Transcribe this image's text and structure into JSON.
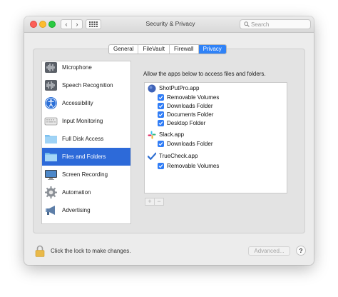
{
  "window": {
    "title": "Security & Privacy",
    "nav_back_icon": "‹",
    "nav_forward_icon": "›",
    "grid_icon": "grid-icon"
  },
  "search": {
    "placeholder": "Search",
    "value": ""
  },
  "tabs": [
    {
      "label": "General",
      "active": false
    },
    {
      "label": "FileVault",
      "active": false
    },
    {
      "label": "Firewall",
      "active": false
    },
    {
      "label": "Privacy",
      "active": true
    }
  ],
  "sidebar": {
    "items": [
      {
        "label": "Microphone",
        "icon": "microphone-icon",
        "selected": false
      },
      {
        "label": "Speech Recognition",
        "icon": "speech-recognition-icon",
        "selected": false
      },
      {
        "label": "Accessibility",
        "icon": "accessibility-icon",
        "selected": false
      },
      {
        "label": "Input Monitoring",
        "icon": "keyboard-icon",
        "selected": false
      },
      {
        "label": "Full Disk Access",
        "icon": "folder-icon",
        "selected": false
      },
      {
        "label": "Files and Folders",
        "icon": "folder-icon",
        "selected": true
      },
      {
        "label": "Screen Recording",
        "icon": "display-icon",
        "selected": false
      },
      {
        "label": "Automation",
        "icon": "gear-icon",
        "selected": false
      },
      {
        "label": "Advertising",
        "icon": "megaphone-icon",
        "selected": false
      }
    ]
  },
  "main": {
    "description": "Allow the apps below to access files and folders.",
    "apps": [
      {
        "name": "ShotPutPro.app",
        "icon": "shotputpro-app-icon",
        "permissions": [
          "Removable Volumes",
          "Downloads Folder",
          "Documents Folder",
          "Desktop Folder"
        ]
      },
      {
        "name": "Slack.app",
        "icon": "slack-app-icon",
        "permissions": [
          "Downloads Folder"
        ]
      },
      {
        "name": "TrueCheck.app",
        "icon": "truecheck-app-icon",
        "permissions": [
          "Removable Volumes"
        ]
      }
    ],
    "add_label": "+",
    "remove_label": "−"
  },
  "footer": {
    "lock_text": "Click the lock to make changes.",
    "advanced_label": "Advanced...",
    "help_label": "?"
  },
  "colors": {
    "accent": "#2f82f7",
    "selection": "#2d6ad9",
    "checkbox": "#2f7cf6"
  }
}
